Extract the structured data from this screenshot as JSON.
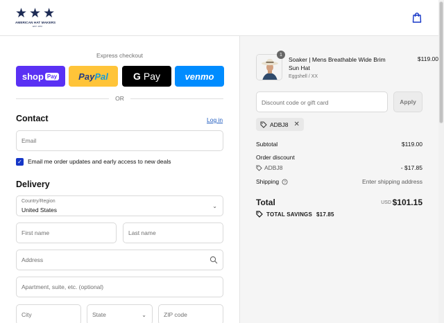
{
  "header": {
    "brand": "AMERICAN HAT MAKERS",
    "brand_est": "EST. 1972",
    "icons": {
      "logo": "three-stars-logo",
      "cart": "shopping-bag-icon"
    }
  },
  "express": {
    "title": "Express checkout",
    "shop_label": "shop",
    "shop_badge": "Pay",
    "paypal_a": "Pay",
    "paypal_b": "Pal",
    "gpay_g": "G",
    "gpay_label": "Pay",
    "venmo_label": "venmo",
    "or_label": "OR",
    "colors": {
      "shop": "#5a31f4",
      "paypal": "#ffc439",
      "gpay": "#000000",
      "venmo": "#008cff"
    }
  },
  "contact": {
    "heading": "Contact",
    "login_link": "Log in",
    "email_placeholder": "Email",
    "newsletter_label": "Email me order updates and early access to new deals",
    "newsletter_checked": true
  },
  "delivery": {
    "heading": "Delivery",
    "country_label": "Country/Region",
    "country_value": "United States",
    "first_name_placeholder": "First name",
    "last_name_placeholder": "Last name",
    "address_placeholder": "Address",
    "apartment_placeholder": "Apartment, suite, etc. (optional)",
    "city_placeholder": "City",
    "state_placeholder": "State",
    "zip_placeholder": "ZIP code"
  },
  "summary": {
    "product": {
      "name": "Soaker | Mens Breathable Wide Brim Sun Hat",
      "variant": "Eggshell / XX",
      "price": "$119.00",
      "quantity": "1"
    },
    "discount_placeholder": "Discount code or gift card",
    "apply_label": "Apply",
    "applied_code": "ADBJ8",
    "subtotal_label": "Subtotal",
    "subtotal_value": "$119.00",
    "order_discount_label": "Order discount",
    "order_discount_code": "ADBJ8",
    "order_discount_value": "- $17.85",
    "shipping_label": "Shipping",
    "shipping_value": "Enter shipping address",
    "total_label": "Total",
    "total_currency": "USD",
    "total_value": "$101.15",
    "savings_label": "TOTAL SAVINGS",
    "savings_value": "$17.85"
  }
}
